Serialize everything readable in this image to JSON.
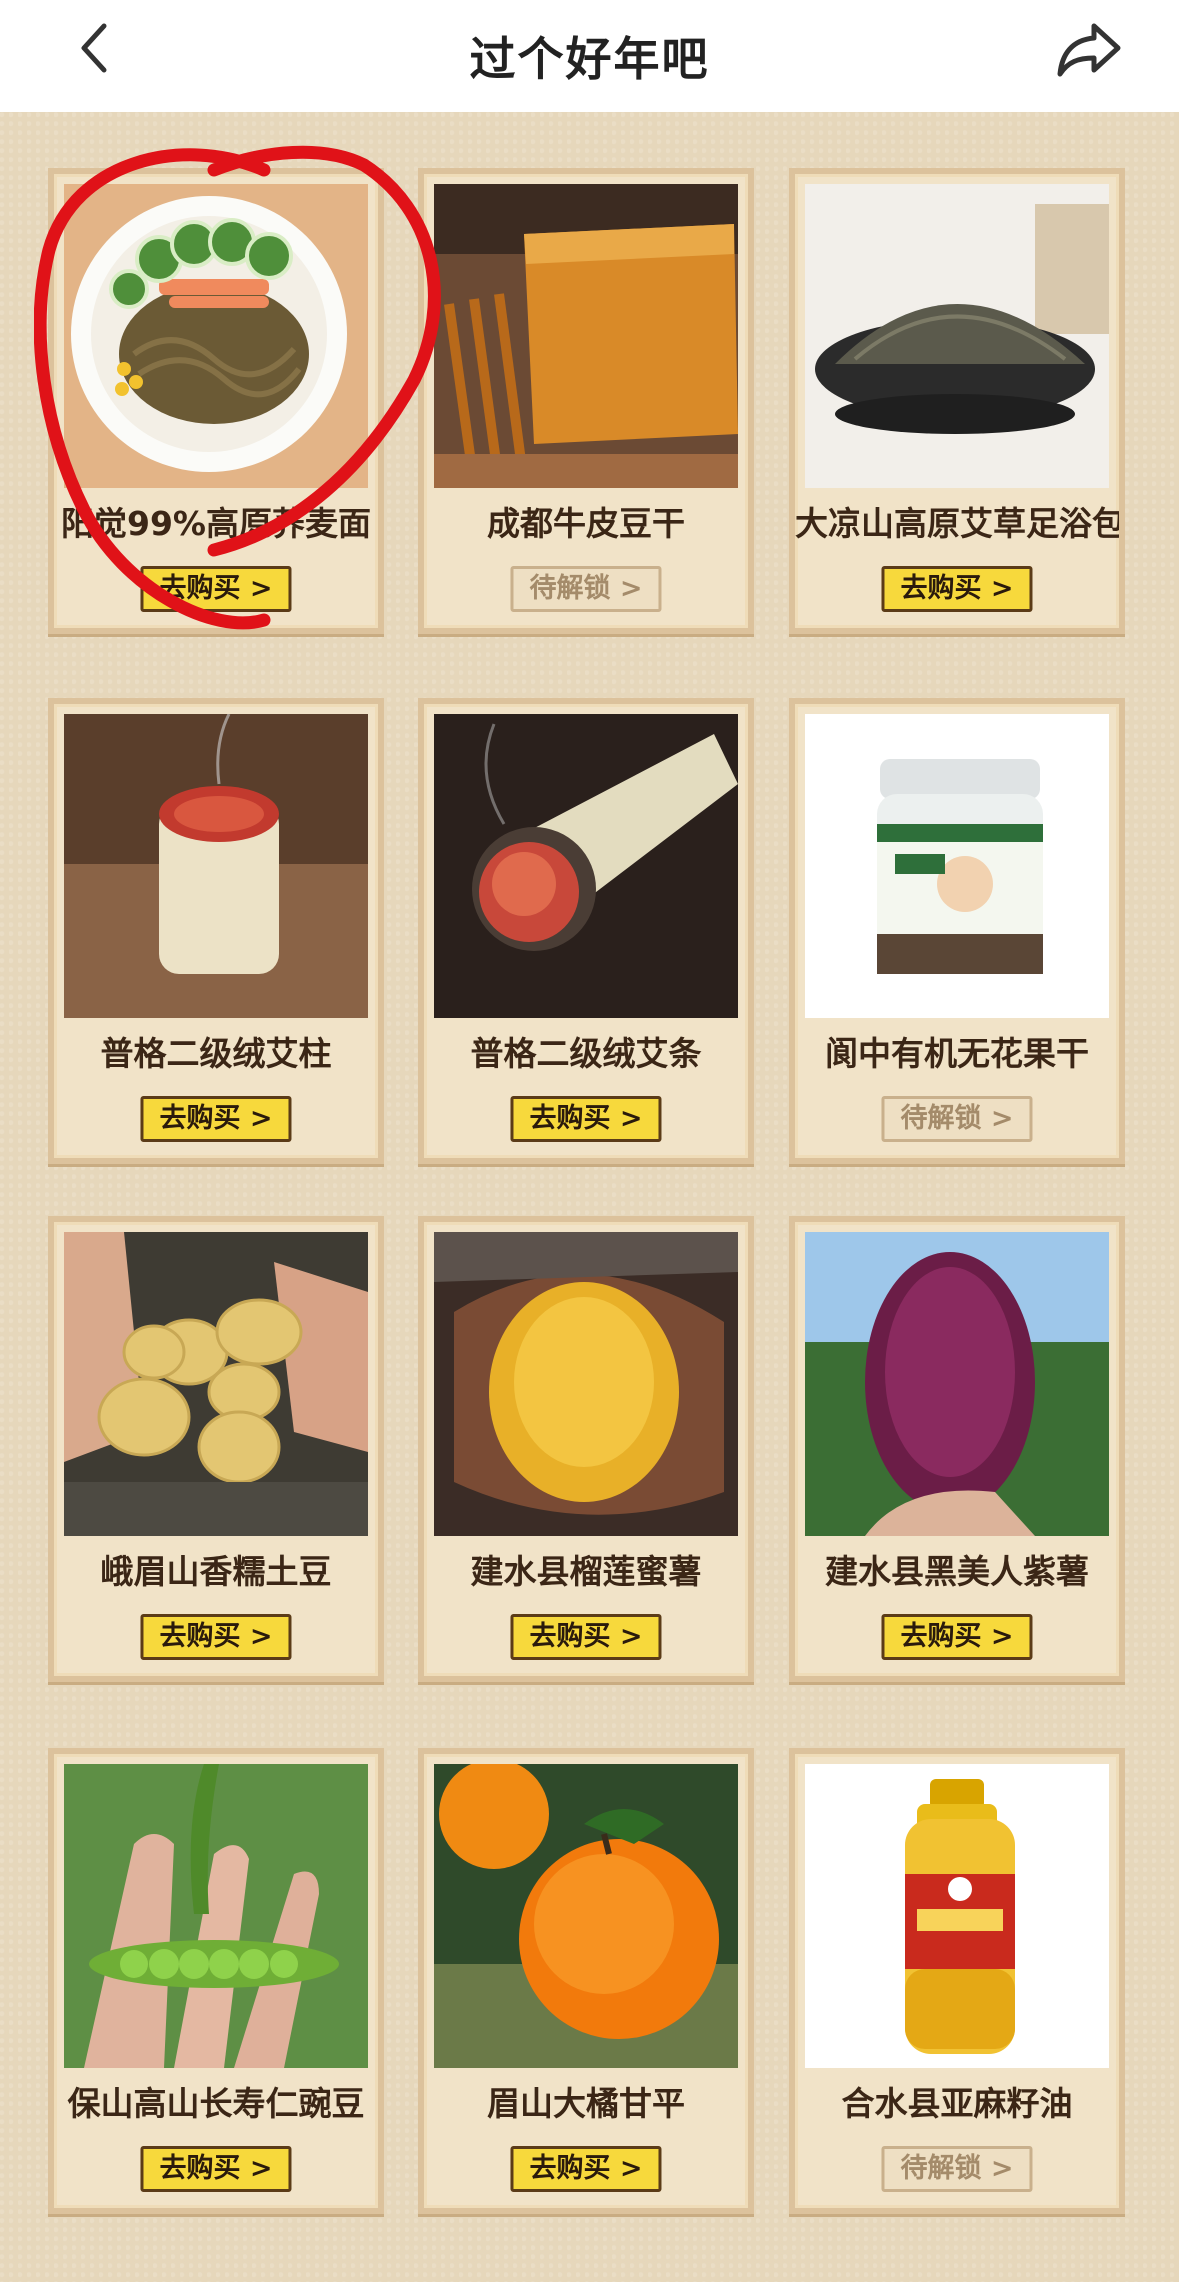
{
  "header": {
    "title": "过个好年吧",
    "back_icon": "chevron-left-icon",
    "share_icon": "share-arrow-icon"
  },
  "colors": {
    "accent_buy": "#f7d93c",
    "card_bg": "#f1e3c8",
    "annotation_red": "#e01218"
  },
  "products": [
    {
      "name": "阳觉99%高原荞麦面",
      "button": "去购买 >",
      "status": "buy",
      "image": "buckwheat-noodles"
    },
    {
      "name": "成都牛皮豆干",
      "button": "待解锁 >",
      "status": "locked",
      "image": "dried-tofu"
    },
    {
      "name": "大凉山高原艾草足浴包",
      "button": "去购买 >",
      "status": "buy",
      "image": "mugwort-footbath"
    },
    {
      "name": "普格二级绒艾柱",
      "button": "去购买 >",
      "status": "buy",
      "image": "moxa-cone"
    },
    {
      "name": "普格二级绒艾条",
      "button": "去购买 >",
      "status": "buy",
      "image": "moxa-stick"
    },
    {
      "name": "阆中有机无花果干",
      "button": "待解锁 >",
      "status": "locked",
      "image": "dried-fig-jar"
    },
    {
      "name": "峨眉山香糯土豆",
      "button": "去购买 >",
      "status": "buy",
      "image": "potatoes"
    },
    {
      "name": "建水县榴莲蜜薯",
      "button": "去购买 >",
      "status": "buy",
      "image": "sweet-potato"
    },
    {
      "name": "建水县黑美人紫薯",
      "button": "去购买 >",
      "status": "buy",
      "image": "purple-sweet-potato"
    },
    {
      "name": "保山高山长寿仁豌豆",
      "button": "去购买 >",
      "status": "buy",
      "image": "peas"
    },
    {
      "name": "眉山大橘甘平",
      "button": "去购买 >",
      "status": "buy",
      "image": "oranges"
    },
    {
      "name": "合水县亚麻籽油",
      "button": "待解锁 >",
      "status": "locked",
      "image": "linseed-oil"
    }
  ],
  "annotation": "red-freehand-circle"
}
